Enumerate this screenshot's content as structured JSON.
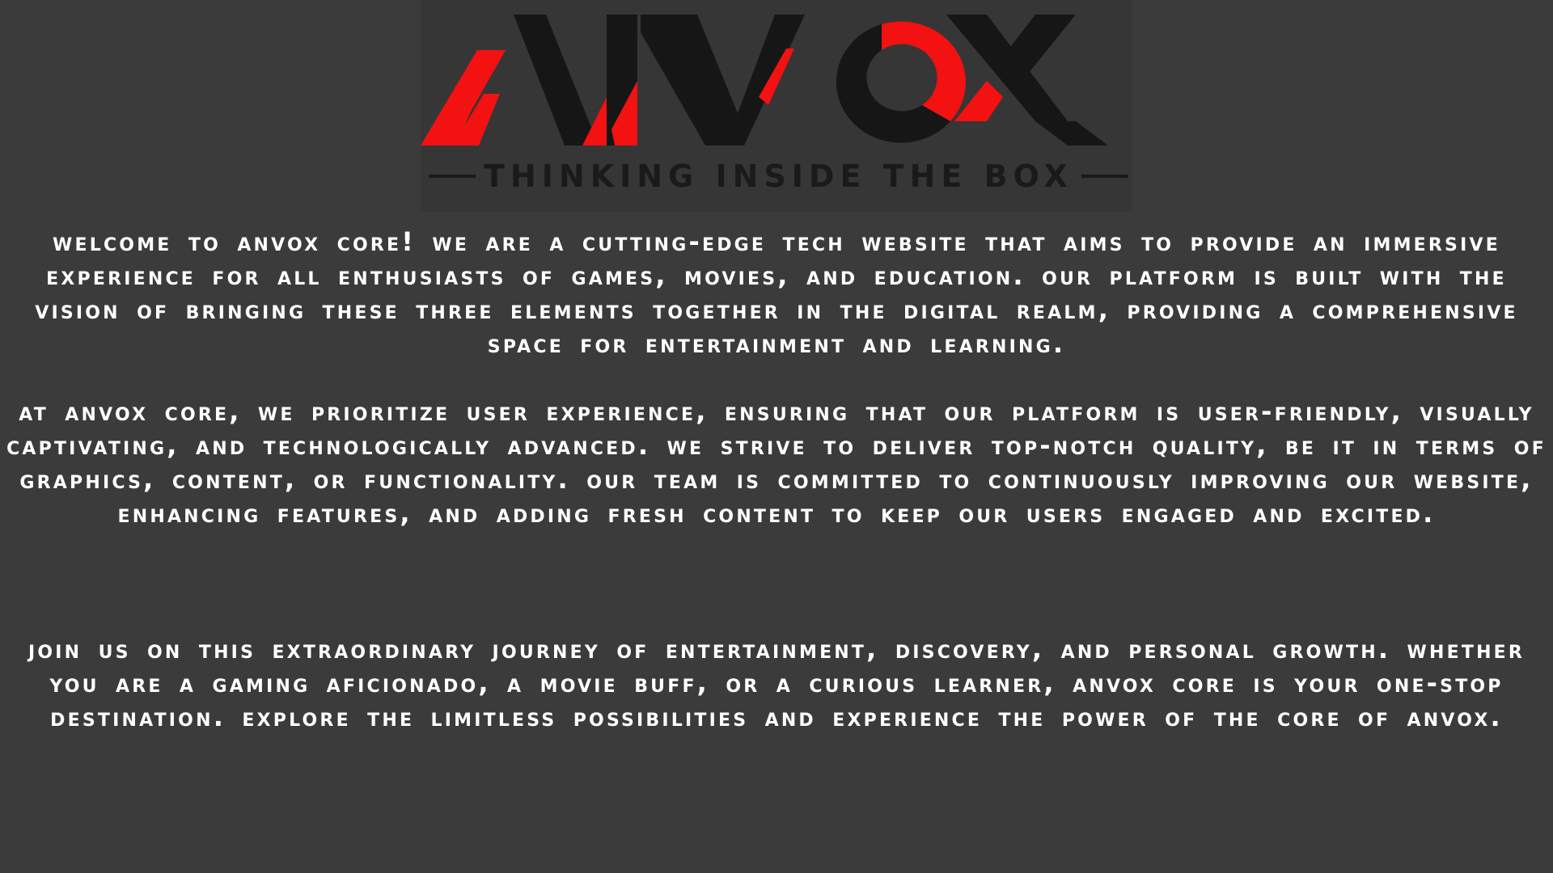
{
  "logo": {
    "wordmark": "ANVOX",
    "tagline": "THINKING INSIDE THE BOX",
    "colors": {
      "red": "#f31111",
      "black": "#161616",
      "background": "#363636"
    }
  },
  "page": {
    "background": "#3b3b3b",
    "text_color": "#ffffff"
  },
  "content": {
    "paragraph_1": "Welcome to Anvox Core! We are a cutting-edge tech website that aims to provide an immersive experience for all enthusiasts of games, movies, and education. Our platform is built with the vision of bringing these three elements together in the digital realm, providing a comprehensive space for entertainment and learning.",
    "paragraph_2": "At Anvox Core, we prioritize user experience, ensuring that our platform is user-friendly, visually captivating, and technologically advanced. We strive to deliver top-notch quality, be it in terms of graphics, content, or functionality. Our team is committed to continuously improving our website, enhancing features, and adding fresh content to keep our users engaged and excited.",
    "paragraph_3": "Join us on this extraordinary journey of entertainment, discovery, and personal growth. Whether you are a gaming aficionado, a movie buff, or a curious learner, Anvox Core is your one-stop destination. Explore the limitless possibilities and experience the power of the Core of Anvox."
  }
}
